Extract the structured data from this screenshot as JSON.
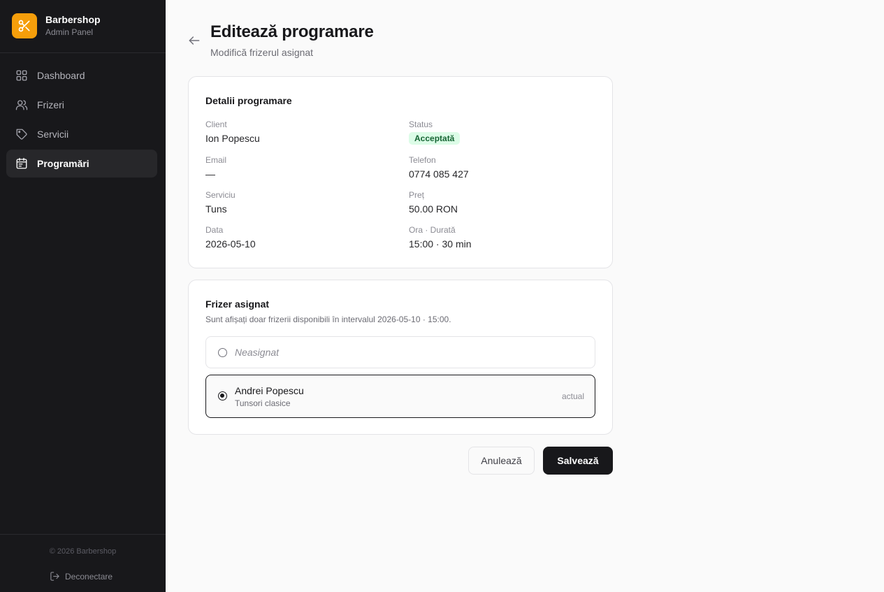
{
  "sidebar": {
    "brand_name": "Barbershop",
    "brand_subtitle": "Admin Panel",
    "brand_icon": "scissors-icon",
    "brand_color": "#f59e0b",
    "items": [
      {
        "label": "Dashboard",
        "icon": "grid-icon",
        "active": false
      },
      {
        "label": "Frizeri",
        "icon": "users-icon",
        "active": false
      },
      {
        "label": "Servicii",
        "icon": "tag-icon",
        "active": false
      },
      {
        "label": "Programări",
        "icon": "calendar-icon",
        "active": true
      }
    ],
    "copyright": "© 2026 Barbershop",
    "logout_label": "Deconectare"
  },
  "header": {
    "title": "Editează programare",
    "subtitle": "Modifică frizerul asignat"
  },
  "details": {
    "title": "Detalii programare",
    "fields": {
      "client": {
        "label": "Client",
        "value": "Ion Popescu"
      },
      "status": {
        "label": "Status",
        "value": "Acceptată"
      },
      "email": {
        "label": "Email",
        "value": "—"
      },
      "phone": {
        "label": "Telefon",
        "value": "0774 085 427"
      },
      "service": {
        "label": "Serviciu",
        "value": "Tuns"
      },
      "price": {
        "label": "Preț",
        "value": "50.00 RON"
      },
      "date": {
        "label": "Data",
        "value": "2026-05-10"
      },
      "time": {
        "label": "Ora · Durată",
        "value": "15:00 · 30 min"
      }
    }
  },
  "barber": {
    "title": "Frizer asignat",
    "description": "Sunt afișați doar frizerii disponibili în intervalul 2026-05-10 · 15:00.",
    "options": [
      {
        "label": "Neasignat",
        "selected": false
      },
      {
        "label": "Andrei Popescu",
        "sublabel": "Tunsori clasice",
        "tag": "actual",
        "selected": true
      }
    ]
  },
  "actions": {
    "cancel_label": "Anulează",
    "save_label": "Salvează"
  }
}
